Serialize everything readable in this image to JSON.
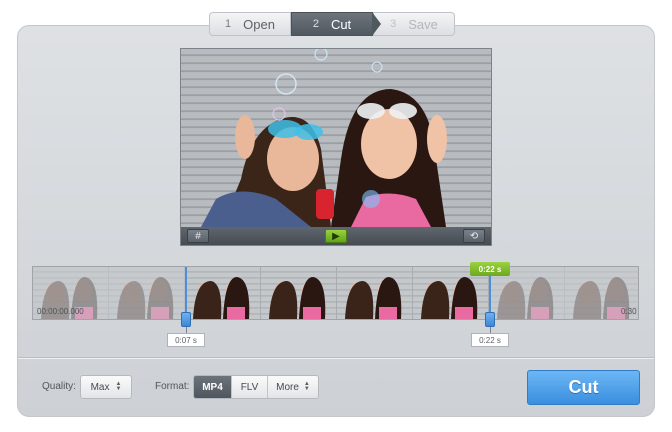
{
  "wizard": {
    "steps": [
      {
        "num": "1",
        "label": "Open"
      },
      {
        "num": "2",
        "label": "Cut"
      },
      {
        "num": "3",
        "label": "Save"
      }
    ]
  },
  "video_controls": {
    "left_icon": "crop-icon",
    "play_icon": "play-icon",
    "right_icon": "rotate-icon"
  },
  "timeline": {
    "start_time": "00:00:00.000",
    "end_time": "0:30",
    "selection_duration": "0:22 s",
    "left_marker_time": "0:07 s",
    "right_marker_time": "0:22 s",
    "selection_start_fraction": 0.25,
    "selection_end_fraction": 0.75
  },
  "bottom": {
    "quality_label": "Quality:",
    "quality_value": "Max",
    "format_label": "Format:",
    "formats": [
      "MP4",
      "FLV",
      "More"
    ],
    "selected_format": "MP4",
    "cut_button": "Cut"
  },
  "colors": {
    "accent_blue": "#3a8fde",
    "accent_green": "#6aa81e",
    "active_step": "#50585f"
  }
}
